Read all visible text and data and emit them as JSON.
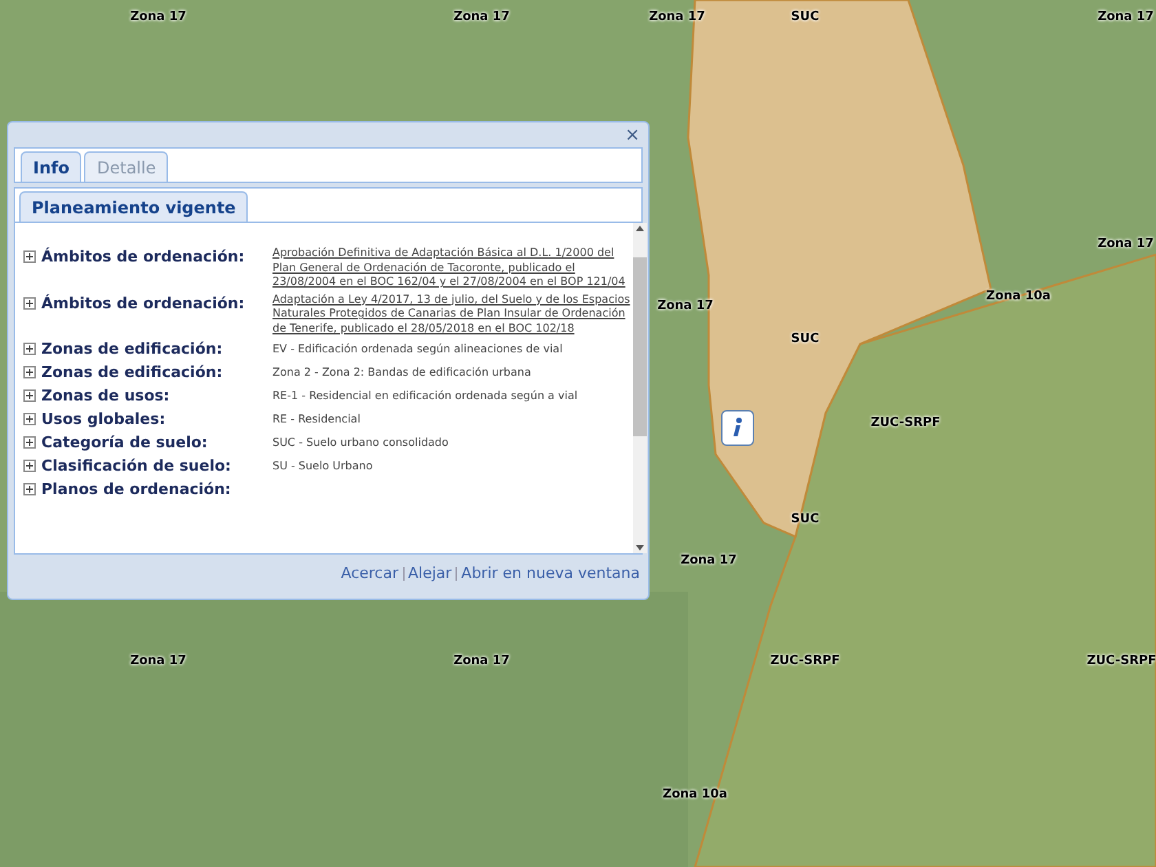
{
  "map_labels": [
    "Zona 17",
    "Zona 17",
    "Zona 17",
    "SUC",
    "Zona 17",
    "Zona 17",
    "Zona 17",
    "SUC",
    "Zona 10a",
    "ZUC-SRPF",
    "SUC",
    "Zona 17",
    "Zona 17",
    "Zona 17",
    "ZUC-SRPF",
    "ZUC-SRPF",
    "Zona 10a"
  ],
  "popup": {
    "close": "×",
    "tabs": [
      {
        "label": "Info",
        "selected": true
      },
      {
        "label": "Detalle",
        "selected": false
      }
    ],
    "subtabs": [
      {
        "label": "Planeamiento vigente",
        "selected": true
      }
    ],
    "rows": [
      {
        "label": "Ámbitos de ordenación:",
        "kind": "link",
        "value": "Aprobación Definitiva de Adaptación Básica al D.L. 1/2000 del Plan General de Ordenación de Tacoronte, publicado el 23/08/2004 en el BOC 162/04 y el 27/08/2004 en el BOP 121/04",
        "expanded": false
      },
      {
        "label": "Ámbitos de ordenación:",
        "kind": "link",
        "value": "Adaptación a Ley 4/2017, 13 de julio, del Suelo y de los Espacios Naturales Protegidos de Canarias de Plan Insular de Ordenación de Tenerife, publicado el 28/05/2018 en el BOC 102/18",
        "expanded": false
      },
      {
        "label": "Zonas de edificación:",
        "kind": "text",
        "value": "EV - Edificación ordenada según alineaciones de vial",
        "expanded": false
      },
      {
        "label": "Zonas de edificación:",
        "kind": "text",
        "value": "Zona 2 - Zona 2: Bandas de edificación urbana",
        "expanded": false
      },
      {
        "label": "Zonas de usos:",
        "kind": "text",
        "value": "RE-1 - Residencial en edificación ordenada según a vial",
        "expanded": false
      },
      {
        "label": "Usos globales:",
        "kind": "text",
        "value": "RE - Residencial",
        "expanded": false
      },
      {
        "label": "Categoría de suelo:",
        "kind": "text",
        "value": "SUC - Suelo urbano consolidado",
        "expanded": false
      },
      {
        "label": "Clasificación de suelo:",
        "kind": "text",
        "value": "SU - Suelo Urbano",
        "expanded": false
      },
      {
        "label": "Planos de ordenación:",
        "expanded": false
      }
    ],
    "links": [
      "Acercar",
      "Alejar",
      "Abrir en nueva ventana"
    ]
  }
}
